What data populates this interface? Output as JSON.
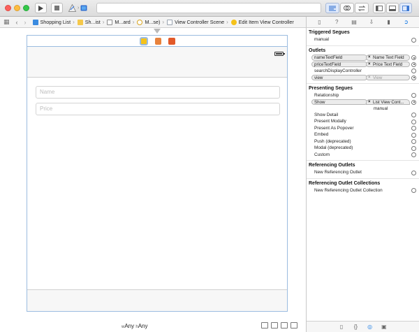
{
  "toolbar": {
    "run_icon": "play-icon",
    "stop_icon": "stop-icon",
    "scheme_icon": "xcode-scheme-icon",
    "device_icon": "device-icon"
  },
  "jumpbar": {
    "crumbs": [
      {
        "label": "Shopping List",
        "color": "#3b8be0"
      },
      {
        "label": "Sh...ist",
        "color": "#f5c84a"
      },
      {
        "label": "M...ard",
        "color": "#8c8c8c"
      },
      {
        "label": "M...se)",
        "color": "#f5c84a"
      },
      {
        "label": "View Controller Scene",
        "color": "#9aa4b0"
      },
      {
        "label": "Edit Item View Controller",
        "color": "#f5c21a"
      }
    ]
  },
  "canvas": {
    "name_placeholder": "Name",
    "price_placeholder": "Price",
    "size_w_label": "w",
    "size_w_value": "Any",
    "size_h_label": "h",
    "size_h_value": "Any"
  },
  "inspector": {
    "triggered_segues": {
      "title": "Triggered Segues",
      "rows": [
        {
          "label": "manual"
        }
      ]
    },
    "outlets": {
      "title": "Outlets",
      "rows": [
        {
          "label": "nameTextField",
          "target": "Name Text Field"
        },
        {
          "label": "priceTextField",
          "target": "Price Text Field"
        },
        {
          "label": "searchDisplayController"
        },
        {
          "label": "view",
          "target": "View"
        }
      ]
    },
    "presenting_segues": {
      "title": "Presenting Segues",
      "rows": [
        {
          "label": "Relationship"
        },
        {
          "label": "Show",
          "target": "List View Cont...",
          "target_sub": "manual"
        },
        {
          "label": "Show Detail"
        },
        {
          "label": "Present Modally"
        },
        {
          "label": "Present As Popover"
        },
        {
          "label": "Embed"
        },
        {
          "label": "Push (deprecated)"
        },
        {
          "label": "Modal (deprecated)"
        },
        {
          "label": "Custom"
        }
      ]
    },
    "referencing_outlets": {
      "title": "Referencing Outlets",
      "rows": [
        {
          "label": "New Referencing Outlet"
        }
      ]
    },
    "referencing_collections": {
      "title": "Referencing Outlet Collections",
      "rows": [
        {
          "label": "New Referencing Outlet Collection"
        }
      ]
    }
  },
  "colors": {
    "accent": "#1e7ee6",
    "scene_border": "#9bbce0"
  }
}
